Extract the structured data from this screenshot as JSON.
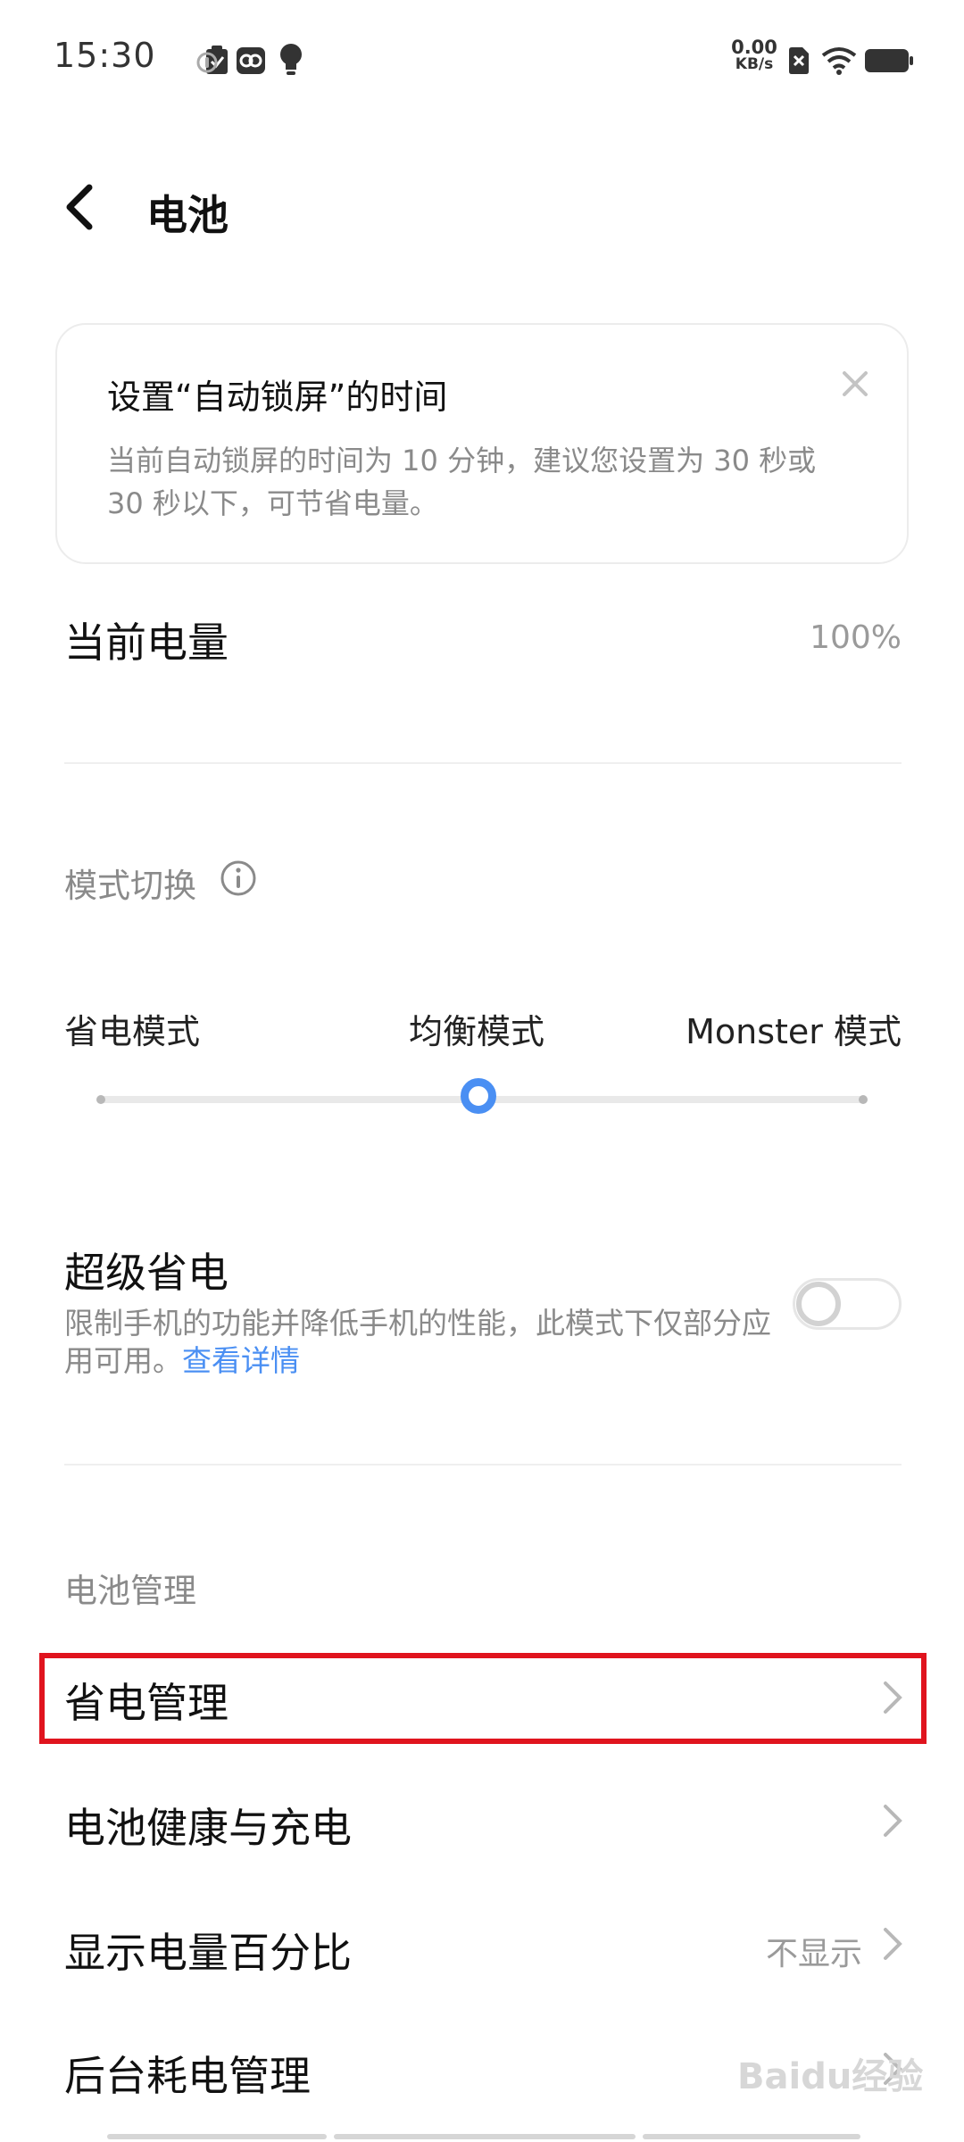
{
  "status_bar": {
    "time": "15:30",
    "net_speed_value": "0.00",
    "net_speed_unit": "KB/s",
    "icons_left": [
      "clipboard-check-icon",
      "app-circle-icon",
      "hotspot-icon",
      "lightbulb-icon"
    ],
    "icons_right": [
      "sim-off-icon",
      "wifi-icon",
      "battery-icon"
    ]
  },
  "header": {
    "title": "电池"
  },
  "tip_card": {
    "title": "设置“自动锁屏”的时间",
    "body": "当前自动锁屏的时间为 10 分钟，建议您设置为 30 秒或 30 秒以下，可节省电量。"
  },
  "current_level": {
    "label": "当前电量",
    "value": "100%"
  },
  "mode_switch": {
    "title": "模式切换",
    "options": [
      "省电模式",
      "均衡模式",
      "Monster 模式"
    ],
    "selected": "均衡模式",
    "accent_color": "#4a8ff3"
  },
  "super_saver": {
    "label": "超级省电",
    "description": "限制手机的功能并降低手机的性能，此模式下仅部分应用可用。",
    "link": "查看详情",
    "enabled": false
  },
  "battery_management": {
    "section_title": "电池管理",
    "items": [
      {
        "label": "省电管理",
        "value": "",
        "highlighted": true
      },
      {
        "label": "电池健康与充电",
        "value": ""
      },
      {
        "label": "显示电量百分比",
        "value": "不显示"
      },
      {
        "label": "后台耗电管理",
        "value": ""
      }
    ]
  },
  "watermark": "Baidu经验",
  "colors": {
    "accent": "#4a8ff3",
    "highlight_border": "#e0141e"
  }
}
